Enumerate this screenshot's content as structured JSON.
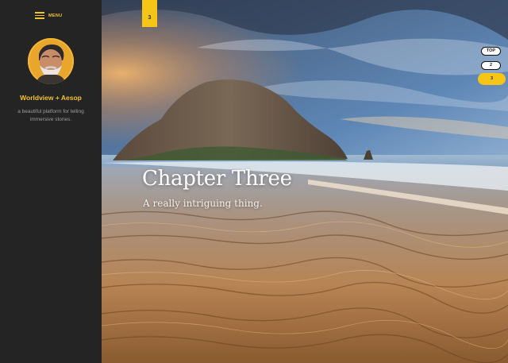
{
  "sidebar": {
    "menu_label": "MENU",
    "site_title": "Worldview + Aesop",
    "tagline": "a beautiful platform for telling immersive stories."
  },
  "chapter": {
    "tab_number": "3",
    "title": "Chapter Three",
    "subtitle": "A really intriguing thing."
  },
  "nav": {
    "items": [
      {
        "label": "TOP"
      },
      {
        "label": "2"
      },
      {
        "label": "3"
      }
    ],
    "active_index": 2
  },
  "colors": {
    "accent": "#f5c518",
    "sidebar_bg": "#242424"
  }
}
